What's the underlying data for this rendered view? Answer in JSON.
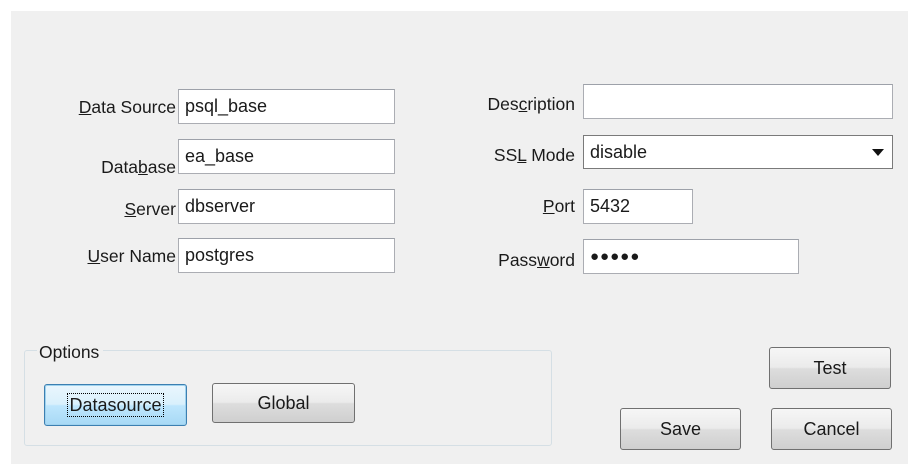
{
  "form": {
    "data_source": {
      "label_pre": "",
      "label_key": "D",
      "label_post": "ata Source",
      "value": "psql_base"
    },
    "database": {
      "label_pre": "Data",
      "label_key": "b",
      "label_post": "ase",
      "value": "ea_base"
    },
    "server": {
      "label_pre": "",
      "label_key": "S",
      "label_post": "erver",
      "value": "dbserver"
    },
    "user_name": {
      "label_pre": "",
      "label_key": "U",
      "label_post": "ser Name",
      "value": "postgres"
    },
    "description": {
      "label_pre": "Des",
      "label_key": "c",
      "label_post": "ription",
      "value": ""
    },
    "ssl_mode": {
      "label_pre": "SS",
      "label_key": "L",
      "label_post": " Mode",
      "value": "disable"
    },
    "port": {
      "label_pre": "",
      "label_key": "P",
      "label_post": "ort",
      "value": "5432"
    },
    "password": {
      "label_pre": "Pass",
      "label_key": "w",
      "label_post": "ord",
      "value": "●●●●●"
    }
  },
  "options": {
    "title": "Options",
    "datasource_label": "Datasource",
    "global_label": "Global"
  },
  "buttons": {
    "test": "Test",
    "save": "Save",
    "cancel": "Cancel"
  },
  "colors": {
    "dialog_bg": "#f0f0f0",
    "focus_button_bg": "#bee6fd"
  }
}
